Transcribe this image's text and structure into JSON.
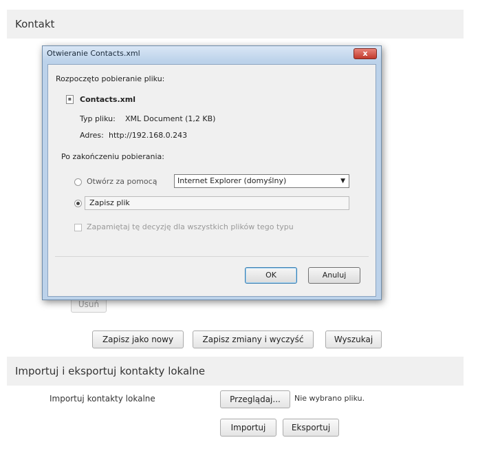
{
  "contact_section": {
    "title": "Kontakt"
  },
  "buttons": {
    "usun": "Usuń",
    "save_as_new": "Zapisz jako nowy",
    "save_and_clear": "Zapisz zmiany i wyczyść",
    "search": "Wyszukaj"
  },
  "import_export": {
    "title": "Importuj i eksportuj kontakty lokalne",
    "import_label": "Importuj kontakty lokalne",
    "browse_button": "Przeglądaj...",
    "no_file": "Nie wybrano pliku.",
    "import_button": "Importuj",
    "export_button": "Eksportuj"
  },
  "dialog": {
    "title": "Otwieranie Contacts.xml",
    "close_label": "x",
    "started_text": "Rozpoczęto pobieranie pliku:",
    "file_name": "Contacts.xml",
    "file_type_label": "Typ pliku:",
    "file_type_value": "XML Document (1,2 KB)",
    "address_label": "Adres:",
    "address_value": "http://192.168.0.243",
    "after_download": "Po zakończeniu pobierania:",
    "open_with_label": "Otwórz za pomocą",
    "open_with_selected": "Internet Explorer (domyślny)",
    "save_file_label": "Zapisz plik",
    "remember_label": "Zapamiętaj tę decyzję dla wszystkich plików tego typu",
    "ok_button": "OK",
    "cancel_button": "Anuluj",
    "selected_option": "save"
  },
  "icons": {
    "file": "file-icon",
    "close": "close-icon",
    "dropdown": "chevron-down-icon"
  }
}
